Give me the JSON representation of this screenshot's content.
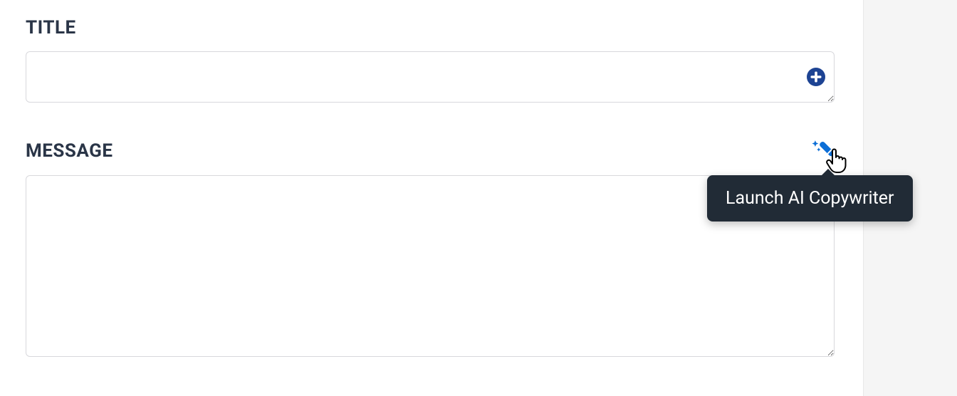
{
  "fields": {
    "title": {
      "label": "TITLE",
      "value": "",
      "placeholder": ""
    },
    "message": {
      "label": "MESSAGE",
      "value": "",
      "placeholder": ""
    }
  },
  "controls": {
    "add_button_name": "add",
    "ai_wand_name": "ai-copywriter"
  },
  "tooltip": {
    "text": "Launch AI Copywriter"
  },
  "colors": {
    "label": "#2a3547",
    "border": "#d8d8dc",
    "accent_blue": "#1d4393",
    "wand_blue": "#0c6ed6",
    "tooltip_bg": "#212b36"
  }
}
